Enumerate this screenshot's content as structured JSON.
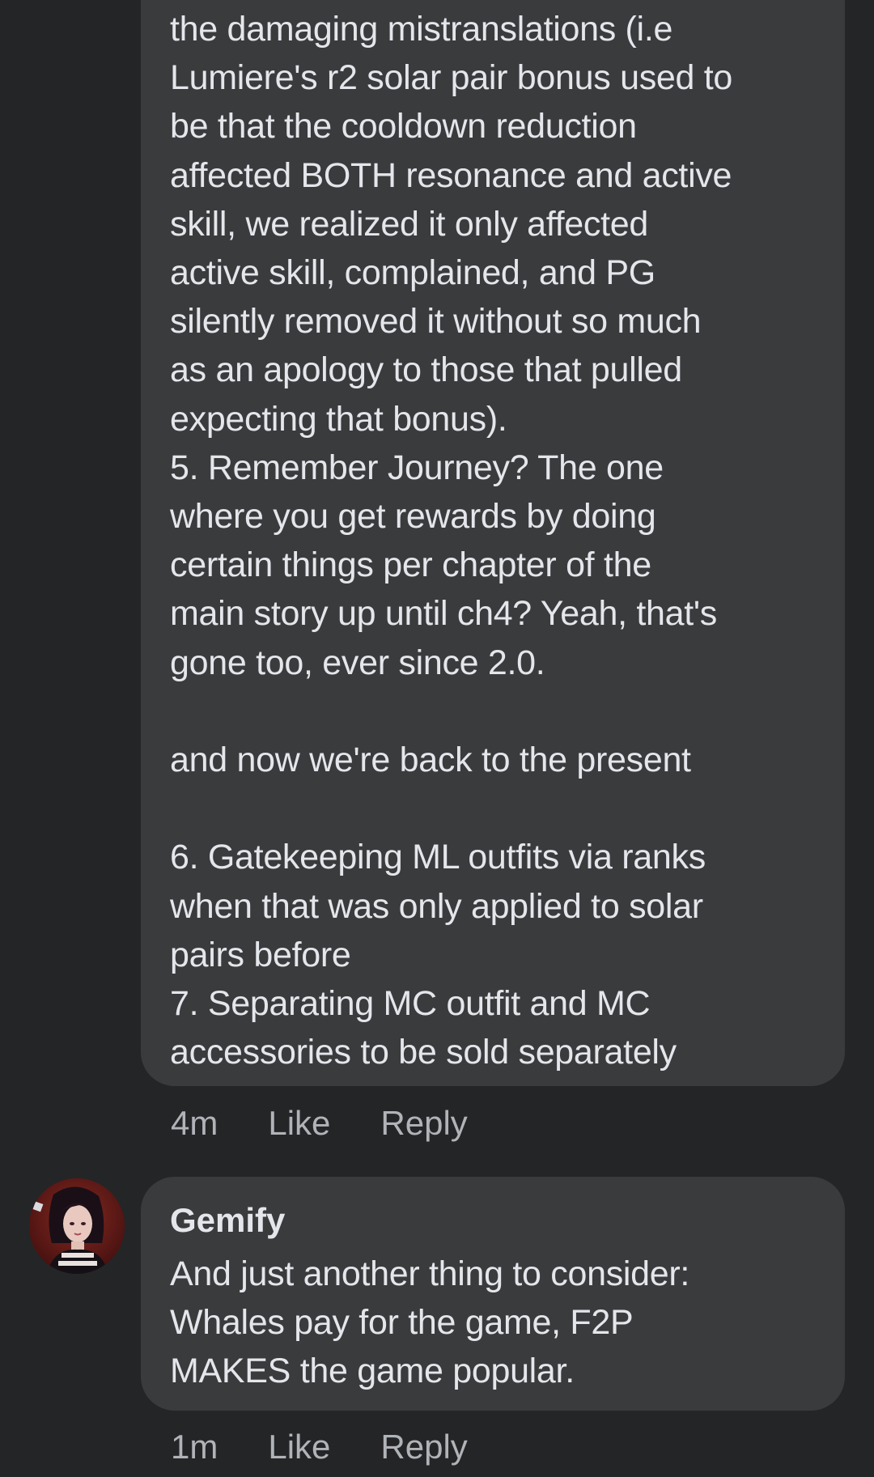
{
  "comments": [
    {
      "body": "the damaging mistranslations (i.e\nLumiere's r2 solar pair bonus used to\nbe that the cooldown reduction\naffected BOTH resonance and active\nskill, we realized it only affected\nactive skill, complained, and PG\nsilently removed it without so much\nas an apology to those that pulled\nexpecting that bonus).\n5. Remember Journey? The one\nwhere you get rewards by doing\ncertain things per chapter of the\nmain story up until ch4? Yeah, that's\ngone too, ever since 2.0.\n\nand now we're back to the present\n\n6. Gatekeeping ML outfits via ranks\nwhen that was only applied to solar\npairs before\n7. Separating MC outfit and MC\naccessories to be sold separately",
      "time": "4m",
      "like_label": "Like",
      "reply_label": "Reply"
    },
    {
      "author": "Gemify",
      "body": "And just another thing to consider:\nWhales pay for the game, F2P\nMAKES the game popular.",
      "time": "1m",
      "like_label": "Like",
      "reply_label": "Reply",
      "avatar_icon": "user-avatar"
    }
  ],
  "colors": {
    "background": "#242526",
    "bubble": "#3a3b3c",
    "text": "#e4e6eb",
    "secondary_text": "#b0b3b8"
  }
}
